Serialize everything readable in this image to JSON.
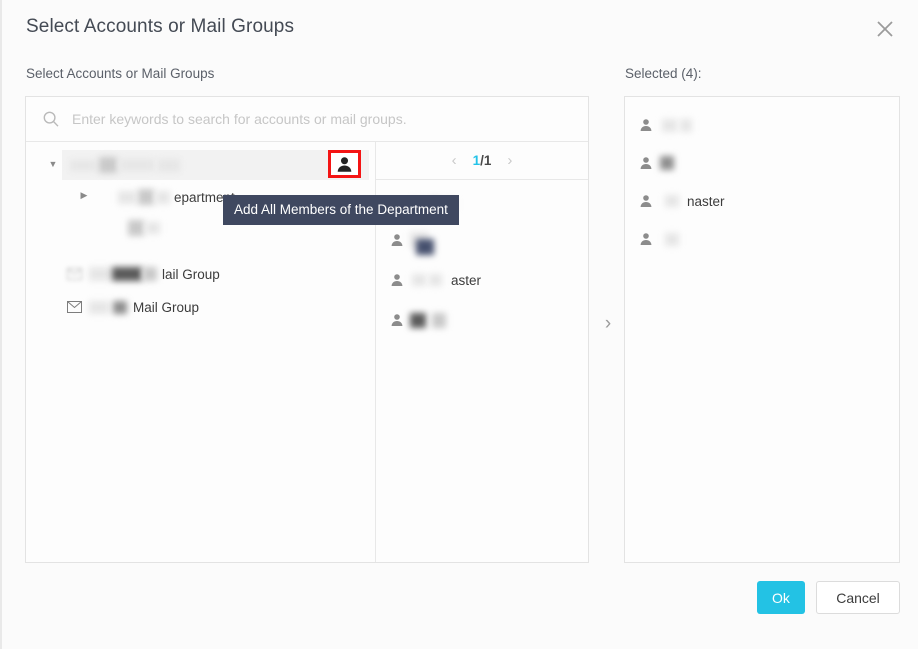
{
  "dialog": {
    "title": "Select Accounts or Mail Groups",
    "close_icon": "close-icon"
  },
  "left": {
    "label": "Select Accounts or Mail Groups",
    "search": {
      "icon": "search-icon",
      "value": "",
      "placeholder": "Enter keywords to search for accounts or mail groups."
    },
    "tree": {
      "root": {
        "caret": "▼",
        "label_redacted": true,
        "add_all_button": {
          "icon": "add-member-icon",
          "tooltip": "Add All Members of the Department",
          "highlight_color": "#f41414"
        }
      },
      "children": [
        {
          "caret": "▶",
          "label": "epartment",
          "redacted_prefix": true
        },
        {
          "caret": "",
          "label": "",
          "redacted_prefix": true
        }
      ],
      "mail_groups": [
        {
          "icon": "mail-group-icon",
          "label": "lail Group",
          "redacted_prefix": true
        },
        {
          "icon": "mail-group-icon",
          "label": "Mail Group",
          "redacted_prefix": true
        }
      ]
    },
    "members": {
      "pagination": {
        "prev_icon": "chevron-left-icon",
        "next_icon": "chevron-right-icon",
        "current": "1",
        "separator": "/",
        "total": "1"
      },
      "items": [
        {
          "icon": "person-icon",
          "label": "",
          "redacted": true
        },
        {
          "icon": "person-icon",
          "label": "",
          "redacted": true
        },
        {
          "icon": "person-icon",
          "label": "aster",
          "redacted_prefix": true
        },
        {
          "icon": "person-icon",
          "label": "",
          "redacted": true
        }
      ]
    }
  },
  "transfer": {
    "icon": "chevron-right-icon"
  },
  "right": {
    "label": "Selected (4):",
    "count": 4,
    "items": [
      {
        "icon": "person-icon",
        "label": "",
        "redacted": true
      },
      {
        "icon": "person-icon",
        "label": "",
        "redacted": true
      },
      {
        "icon": "person-icon",
        "label": "naster",
        "redacted_prefix": true
      },
      {
        "icon": "person-icon",
        "label": "",
        "redacted": true
      }
    ]
  },
  "footer": {
    "ok_label": "Ok",
    "cancel_label": "Cancel",
    "ok_color": "#23c2e4"
  }
}
